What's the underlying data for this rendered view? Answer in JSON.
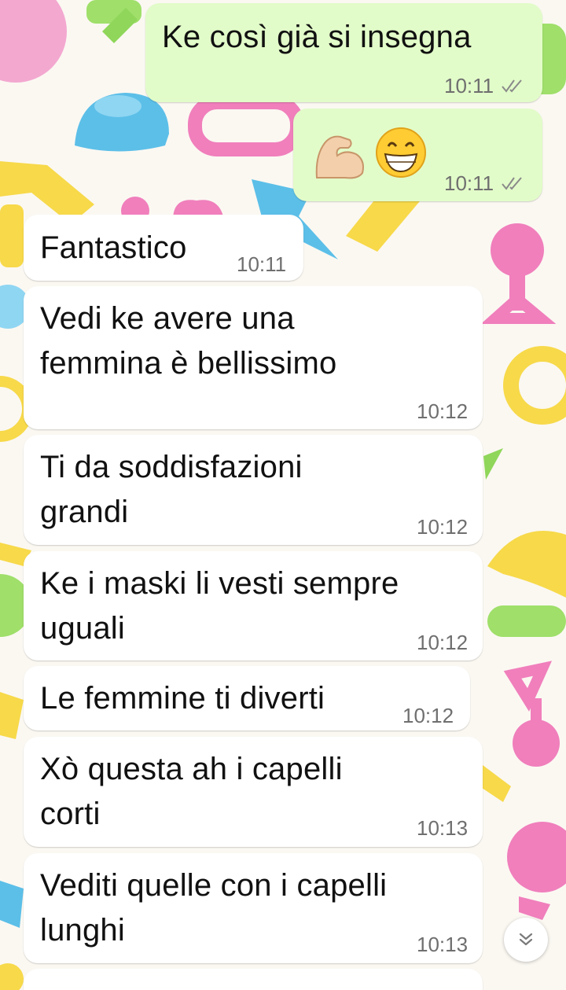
{
  "chat": {
    "messages": [
      {
        "direction": "outgoing",
        "text": "Ke così già si insegna",
        "time": "10:11",
        "status": "read"
      },
      {
        "direction": "outgoing",
        "emoji": [
          "flexed-biceps-emoji",
          "grinning-face-emoji"
        ],
        "time": "10:11",
        "status": "read"
      },
      {
        "direction": "incoming",
        "text": "Fantastico",
        "time": "10:11"
      },
      {
        "direction": "incoming",
        "text": "Vedi ke avere una\nfemmina è bellissimo",
        "time": "10:12"
      },
      {
        "direction": "incoming",
        "text": "Ti da soddisfazioni\ngrandi",
        "time": "10:12"
      },
      {
        "direction": "incoming",
        "text": "Ke i maski li vesti sempre\nuguali",
        "time": "10:12"
      },
      {
        "direction": "incoming",
        "text": "Le femmine ti diverti",
        "time": "10:12"
      },
      {
        "direction": "incoming",
        "text": "Xò questa ah i capelli\ncorti",
        "time": "10:13"
      },
      {
        "direction": "incoming",
        "text": "Vediti quelle con i capelli\nlunghi",
        "time": "10:13"
      }
    ]
  },
  "colors": {
    "outgoing_bubble": "#e2fcc9",
    "incoming_bubble": "#ffffff",
    "read_ticks": "#8a8a8a"
  },
  "icons": {
    "scroll_down": "double-chevron-down-icon"
  }
}
